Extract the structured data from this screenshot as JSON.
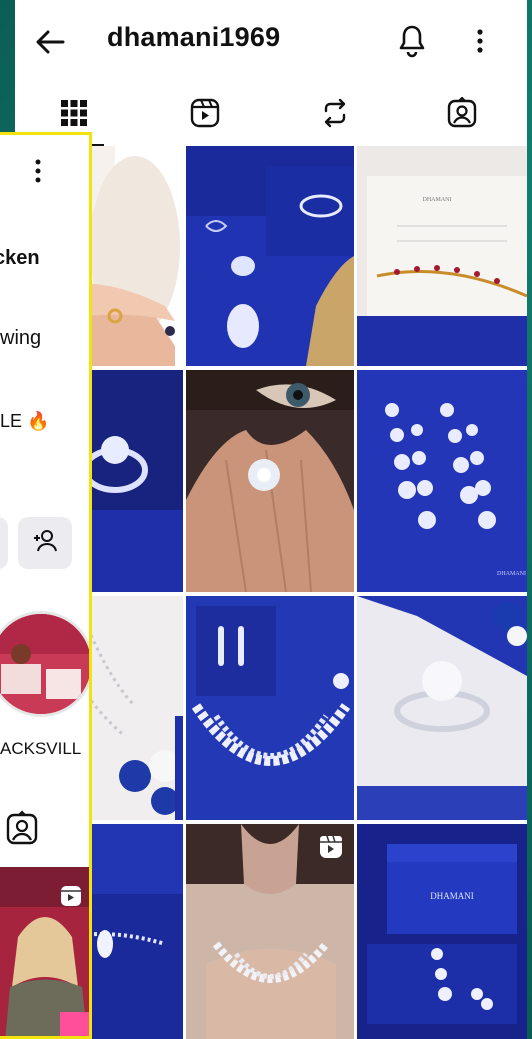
{
  "profile": {
    "username": "dhamani1969",
    "tabs": [
      {
        "name": "posts-grid-icon",
        "active": true
      },
      {
        "name": "reels-icon",
        "active": false
      },
      {
        "name": "reposts-icon",
        "active": false
      },
      {
        "name": "tagged-icon",
        "active": false
      }
    ]
  },
  "overlay": {
    "name_fragment": "cken",
    "following_fragment": "wing",
    "bio_fragment": "LE 🔥",
    "highlight_label": "ACKSVILL"
  },
  "colors": {
    "brand_blue": "#1e2fa8",
    "overlay_border": "#f2e20e",
    "background_teal": "#0f7a6a"
  },
  "grid_posts": [
    {
      "name": "post-hand-ring",
      "reel": false
    },
    {
      "name": "post-rings-on-blue",
      "reel": false
    },
    {
      "name": "post-card-bracelet",
      "reel": false
    },
    {
      "name": "post-ring-closeup",
      "reel": false
    },
    {
      "name": "post-eye-ring",
      "reel": false
    },
    {
      "name": "post-drop-earrings",
      "reel": false
    },
    {
      "name": "post-necklace-white",
      "reel": false
    },
    {
      "name": "post-earrings-necklace-box",
      "reel": false
    },
    {
      "name": "post-cluster-ring",
      "reel": false
    },
    {
      "name": "post-bracelet-box",
      "reel": false
    },
    {
      "name": "post-model-necklace",
      "reel": true
    },
    {
      "name": "post-dhamani-box",
      "reel": false
    }
  ]
}
